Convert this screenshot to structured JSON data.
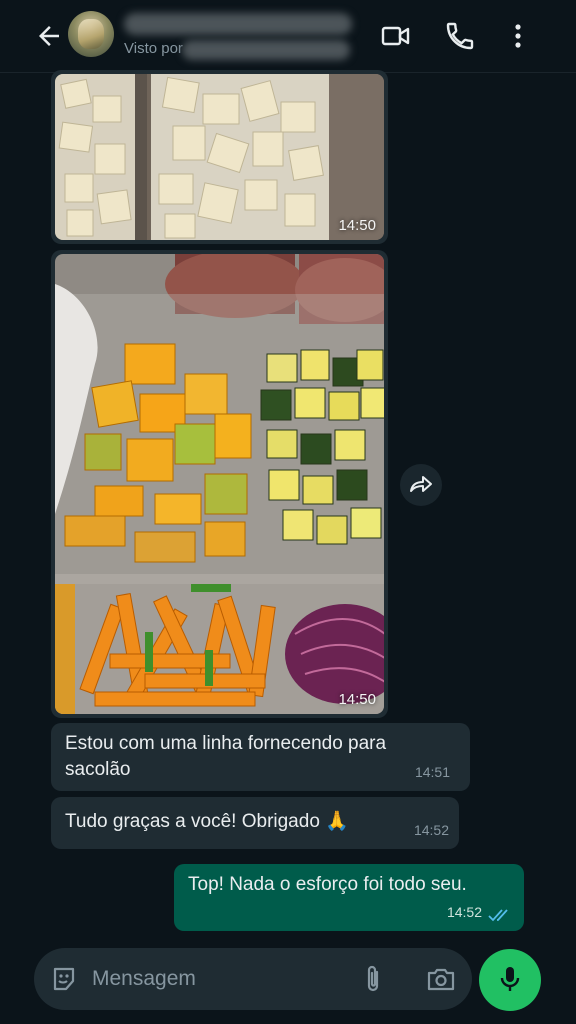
{
  "header": {
    "contact_name": "",
    "status": "Visto por",
    "icons": [
      "back-arrow-icon",
      "video-call-icon",
      "phone-call-icon",
      "more-options-icon"
    ]
  },
  "messages": [
    {
      "type": "image",
      "content": "diced white vegetables in bags",
      "time": "14:50"
    },
    {
      "type": "image",
      "content": "diced pumpkin, zucchini, carrot sticks and red cabbage in bags",
      "time": "14:50"
    },
    {
      "type": "text",
      "direction": "incoming",
      "text": "Estou com uma linha fornecendo para sacolão",
      "time": "14:51"
    },
    {
      "type": "text",
      "direction": "incoming",
      "text": "Tudo graças a você! Obrigado 🙏",
      "time": "14:52"
    },
    {
      "type": "text",
      "direction": "outgoing",
      "text": "Top! Nada o esforço foi todo seu.",
      "time": "14:52",
      "read_status": "read"
    }
  ],
  "composer": {
    "placeholder": "Mensagem",
    "icons": [
      "sticker-icon",
      "attach-icon",
      "camera-icon",
      "mic-icon"
    ]
  },
  "colors": {
    "background": "#0b141a",
    "incoming_bubble": "#1f2c33",
    "outgoing_bubble": "#005c4b",
    "accent": "#21c063",
    "read_ticks": "#53bdeb"
  }
}
